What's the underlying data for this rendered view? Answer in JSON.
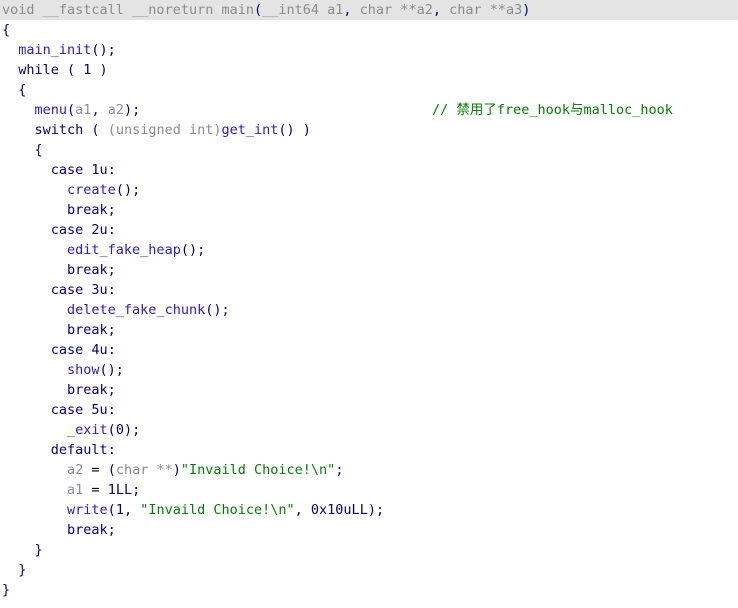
{
  "view": {
    "name": "IDA Pseudocode",
    "background_color": "#ffffff",
    "current_line_highlight_color": "#e4e4e4"
  },
  "palette": {
    "keyword": "#00007f",
    "function": "#2222cc",
    "string": "#008000",
    "comment": "#008000",
    "type": "#8c8c8c",
    "variable": "#8c8cb4",
    "punctuation": "#00007f",
    "declaration": "#8c8c8c"
  },
  "code": {
    "line1": {
      "ret": "void ",
      "cc": "__fastcall ",
      "attr": "__noreturn ",
      "name": "main",
      "lparen": "(",
      "p1type": "__int64 ",
      "p1name": "a1",
      "comma1": ", ",
      "p2type": "char ",
      "p2stars": "**",
      "p2name": "a2",
      "comma2": ", ",
      "p3type": "char ",
      "p3stars": "**",
      "p3name": "a3",
      "rparen": ")"
    },
    "line2": {
      "brace": "{"
    },
    "line3": {
      "indent": "  ",
      "fn": "main_init",
      "tail": "();"
    },
    "line4": {
      "indent": "  ",
      "kw": "while",
      "cond": " ( 1 )"
    },
    "line5": {
      "indent": "  ",
      "brace": "{"
    },
    "line6": {
      "indent": "    ",
      "fn": "menu",
      "lparen": "(",
      "arg1": "a1",
      "comma": ", ",
      "arg2": "a2",
      "tail": ");",
      "comment": "// 禁用了free_hook与malloc_hook"
    },
    "line7": {
      "indent": "    ",
      "kw": "switch",
      "open": " ( ",
      "cast": "(unsigned int)",
      "fn": "get_int",
      "tail": "() )"
    },
    "line8": {
      "indent": "    ",
      "brace": "{"
    },
    "line9": {
      "indent": "      ",
      "kw": "case ",
      "num": "1u",
      "colon": ":"
    },
    "line10": {
      "indent": "        ",
      "fn": "create",
      "tail": "();"
    },
    "line11": {
      "indent": "        ",
      "kw": "break",
      "tail": ";"
    },
    "line12": {
      "indent": "      ",
      "kw": "case ",
      "num": "2u",
      "colon": ":"
    },
    "line13": {
      "indent": "        ",
      "fn": "edit_fake_heap",
      "tail": "();"
    },
    "line14": {
      "indent": "        ",
      "kw": "break",
      "tail": ";"
    },
    "line15": {
      "indent": "      ",
      "kw": "case ",
      "num": "3u",
      "colon": ":"
    },
    "line16": {
      "indent": "        ",
      "fn": "delete_fake_chunk",
      "tail": "();"
    },
    "line17": {
      "indent": "        ",
      "kw": "break",
      "tail": ";"
    },
    "line18": {
      "indent": "      ",
      "kw": "case ",
      "num": "4u",
      "colon": ":"
    },
    "line19": {
      "indent": "        ",
      "fn": "show",
      "tail": "();"
    },
    "line20": {
      "indent": "        ",
      "kw": "break",
      "tail": ";"
    },
    "line21": {
      "indent": "      ",
      "kw": "case ",
      "num": "5u",
      "colon": ":"
    },
    "line22": {
      "indent": "        ",
      "fn": "_exit",
      "lparen": "(",
      "num": "0",
      "tail": ");"
    },
    "line23": {
      "indent": "      ",
      "kw": "default",
      "colon": ":"
    },
    "line24": {
      "indent": "        ",
      "var": "a2",
      "eq": " = ",
      "castopen": "(",
      "casttype": "char **",
      "castclose": ")",
      "str": "\"Invaild Choice!\\n\"",
      "tail": ";"
    },
    "line25": {
      "indent": "        ",
      "var": "a1",
      "eq": " = ",
      "num": "1LL",
      "tail": ";"
    },
    "line26": {
      "indent": "        ",
      "fn": "write",
      "lparen": "(",
      "num1": "1",
      "comma1": ", ",
      "str": "\"Invaild Choice!\\n\"",
      "comma2": ", ",
      "num2": "0x10uLL",
      "tail": ");"
    },
    "line27": {
      "indent": "        ",
      "kw": "break",
      "tail": ";"
    },
    "line28": {
      "indent": "    ",
      "brace": "}"
    },
    "line29": {
      "indent": "  ",
      "brace": "}"
    },
    "line30": {
      "brace": "}"
    }
  }
}
